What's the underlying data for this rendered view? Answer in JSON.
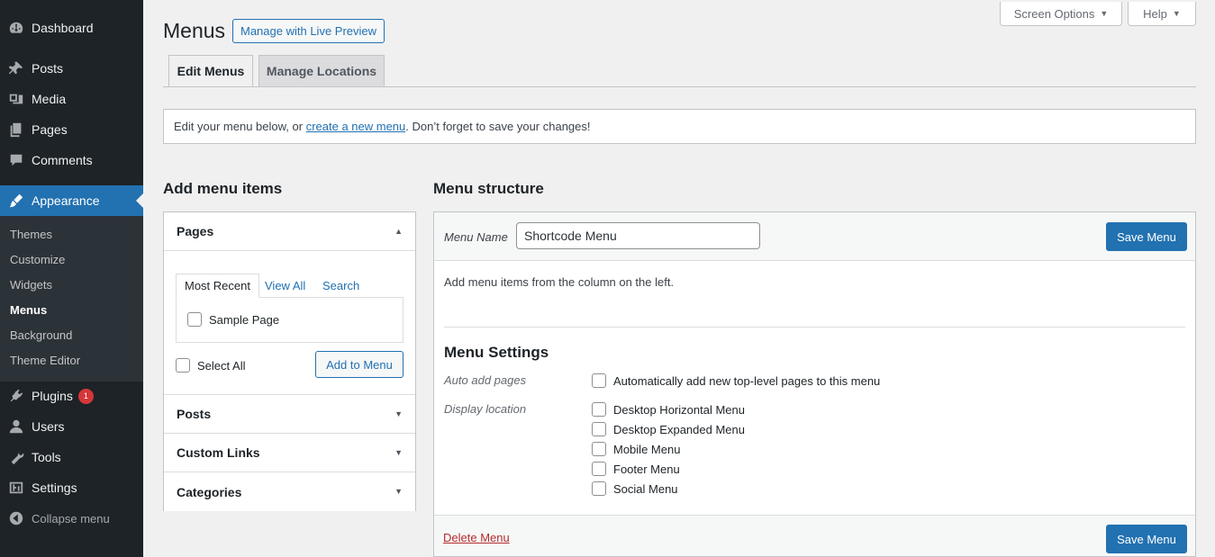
{
  "sidebar": {
    "items": [
      {
        "key": "dashboard",
        "label": "Dashboard",
        "icon": "dashboard-icon"
      },
      {
        "key": "posts",
        "label": "Posts",
        "icon": "pin-icon"
      },
      {
        "key": "media",
        "label": "Media",
        "icon": "media-icon"
      },
      {
        "key": "pages",
        "label": "Pages",
        "icon": "pages-icon"
      },
      {
        "key": "comments",
        "label": "Comments",
        "icon": "comment-icon"
      },
      {
        "key": "appearance",
        "label": "Appearance",
        "icon": "brush-icon"
      },
      {
        "key": "plugins",
        "label": "Plugins",
        "icon": "plugin-icon",
        "badge": "1"
      },
      {
        "key": "users",
        "label": "Users",
        "icon": "user-icon"
      },
      {
        "key": "tools",
        "label": "Tools",
        "icon": "wrench-icon"
      },
      {
        "key": "settings",
        "label": "Settings",
        "icon": "settings-icon"
      }
    ],
    "submenu": [
      "Themes",
      "Customize",
      "Widgets",
      "Menus",
      "Background",
      "Theme Editor"
    ],
    "collapse": "Collapse menu"
  },
  "screen_options": "Screen Options",
  "help": "Help",
  "page": {
    "title": "Menus",
    "live_preview": "Manage with Live Preview",
    "tabs": [
      "Edit Menus",
      "Manage Locations"
    ],
    "notice": {
      "before": "Edit your menu below, or ",
      "link": "create a new menu",
      "after": ". Don’t forget to save your changes!"
    }
  },
  "add_items": {
    "heading": "Add menu items",
    "sections": [
      "Pages",
      "Posts",
      "Custom Links",
      "Categories"
    ],
    "inner_tabs": [
      "Most Recent",
      "View All",
      "Search"
    ],
    "page_item": "Sample Page",
    "select_all": "Select All",
    "add_button": "Add to Menu"
  },
  "structure": {
    "heading": "Menu structure",
    "name_label": "Menu Name",
    "name_value": "Shortcode Menu",
    "save_label": "Save Menu",
    "instructions": "Add menu items from the column on the left.",
    "settings_title": "Menu Settings",
    "auto_add_label": "Auto add pages",
    "auto_add_option": "Automatically add new top-level pages to this menu",
    "display_label": "Display location",
    "locations": [
      "Desktop Horizontal Menu",
      "Desktop Expanded Menu",
      "Mobile Menu",
      "Footer Menu",
      "Social Menu"
    ],
    "delete_label": "Delete Menu"
  },
  "colors": {
    "sidebar_bg": "#1d2327",
    "accent": "#2271b1",
    "danger": "#b32d2e"
  }
}
